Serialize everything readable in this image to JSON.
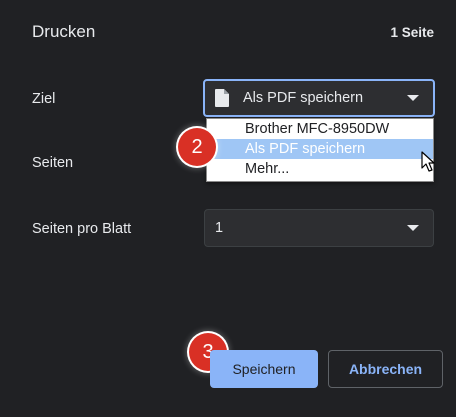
{
  "dialog": {
    "title": "Drucken",
    "page_count": "1 Seite"
  },
  "fields": {
    "destination_label": "Ziel",
    "destination_value": "Als PDF speichern",
    "pages_label": "Seiten",
    "pages_per_sheet_label": "Seiten pro Blatt",
    "pages_per_sheet_value": "1"
  },
  "dropdown": {
    "options": [
      "Brother MFC-8950DW",
      "Als PDF speichern",
      "Mehr..."
    ],
    "highlighted_index": 1
  },
  "badges": {
    "step2": "2",
    "step3": "3"
  },
  "buttons": {
    "save": "Speichern",
    "cancel": "Abbrechen"
  },
  "icons": {
    "destination": "document-icon",
    "cursor": "mouse-pointer-icon"
  },
  "colors": {
    "background": "#202124",
    "accent": "#8ab4f8",
    "badge": "#d93025",
    "highlight": "#9fc6f5"
  }
}
